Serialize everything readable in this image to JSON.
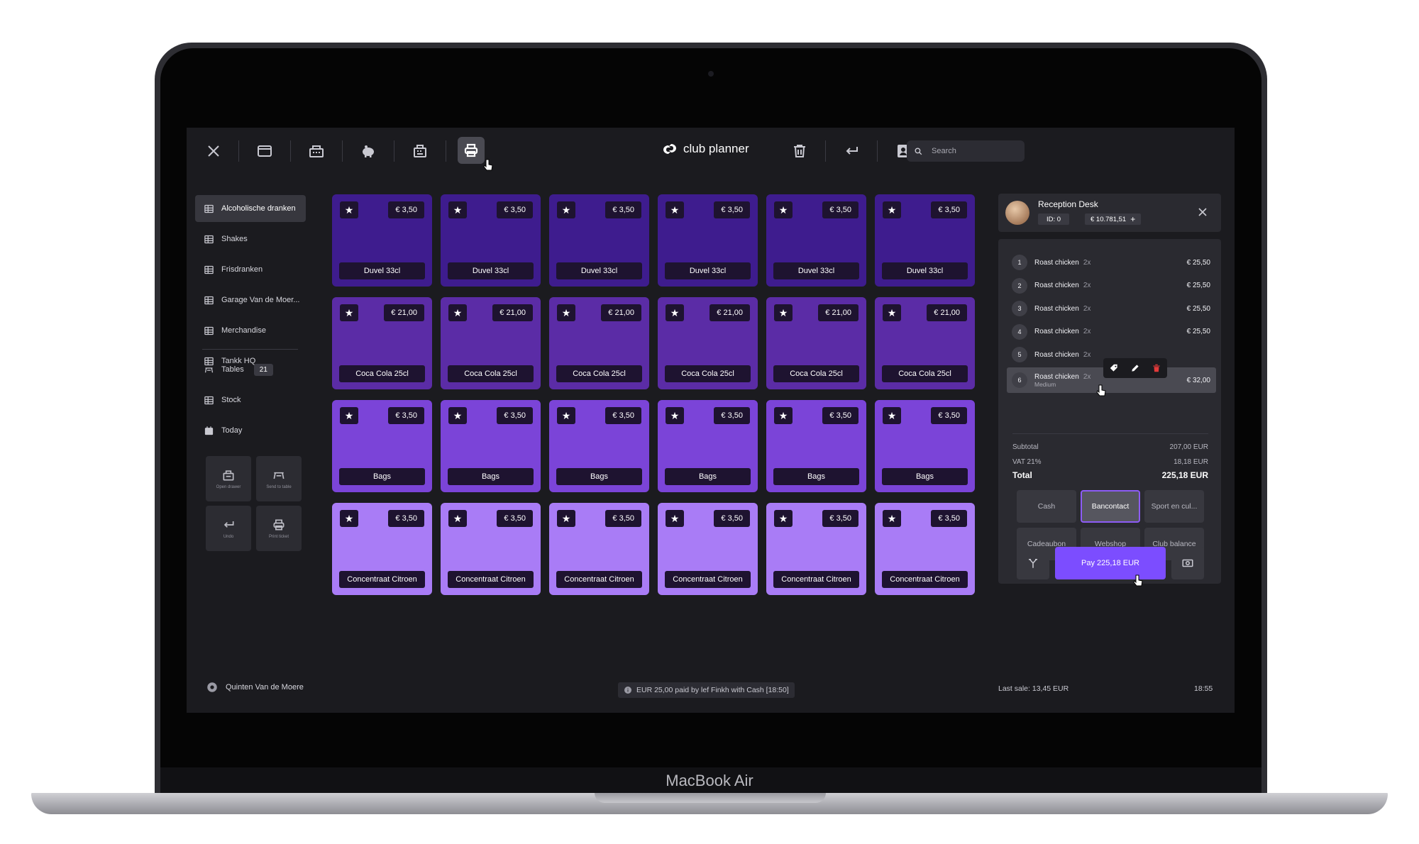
{
  "device": {
    "label": "MacBook Air"
  },
  "header": {
    "logo_text": "club planner",
    "search_placeholder": "Search",
    "toolbar_icons": [
      "close-icon",
      "wallet-icon",
      "cash-register-icon",
      "piggy-bank-icon",
      "calculator-icon",
      "printer-icon",
      "trash-icon",
      "return-icon",
      "contact-card-icon",
      "search-icon"
    ]
  },
  "sidebar": {
    "categories": [
      {
        "label": "Alcoholische dranken",
        "active": true
      },
      {
        "label": "Shakes"
      },
      {
        "label": "Frisdranken"
      },
      {
        "label": "Garage Van de Moer..."
      },
      {
        "label": "Merchandise"
      },
      {
        "label": "Tankk HQ"
      }
    ],
    "tables": {
      "label": "Tables",
      "count": "21"
    },
    "stock": {
      "label": "Stock"
    },
    "today": {
      "label": "Today"
    },
    "quick_actions": [
      {
        "label": "Open drawer"
      },
      {
        "label": "Send to table"
      },
      {
        "label": "Undo"
      },
      {
        "label": "Print ticket"
      }
    ],
    "user": {
      "name": "Quinten Van de Moere"
    }
  },
  "products": {
    "rows": [
      {
        "name": "Duvel 33cl",
        "price": "€ 3,50",
        "color": "#3e1c8e"
      },
      {
        "name": "Coca Cola 25cl",
        "price": "€ 21,00",
        "color": "#5b2ca6"
      },
      {
        "name": "Bags",
        "price": "€ 3,50",
        "color": "#7b44d8"
      },
      {
        "name": "Concentraat Citroen",
        "price": "€ 3,50",
        "color": "#a97cf6"
      }
    ],
    "star_glyph": "★"
  },
  "customer": {
    "name": "Reception Desk",
    "id": "ID: 0",
    "balance": "€ 10.781,51",
    "add_glyph": "+"
  },
  "ticket": {
    "lines": [
      {
        "num": "1",
        "name": "Roast chicken",
        "qty": "2x",
        "amount": "€ 25,50"
      },
      {
        "num": "2",
        "name": "Roast chicken",
        "qty": "2x",
        "amount": "€ 25,50"
      },
      {
        "num": "3",
        "name": "Roast chicken",
        "qty": "2x",
        "amount": "€ 25,50"
      },
      {
        "num": "4",
        "name": "Roast chicken",
        "qty": "2x",
        "amount": "€ 25,50"
      },
      {
        "num": "5",
        "name": "Roast chicken",
        "qty": "2x",
        "amount": ""
      },
      {
        "num": "6",
        "name": "Roast chicken",
        "qty": "2x",
        "amount": "€ 32,00",
        "note": "Medium",
        "selected": true
      }
    ]
  },
  "totals": {
    "subtotal_label": "Subtotal",
    "subtotal": "207,00 EUR",
    "vat_label": "VAT 21%",
    "vat": "18,18 EUR",
    "total_label": "Total",
    "total": "225,18 EUR"
  },
  "payment_methods": [
    {
      "label": "Cash"
    },
    {
      "label": "Bancontact",
      "selected": true
    },
    {
      "label": "Sport en cul..."
    },
    {
      "label": "Cadeaubon"
    },
    {
      "label": "Webshop"
    },
    {
      "label": "Club balance"
    }
  ],
  "pay_button": {
    "label": "Pay 225,18 EUR"
  },
  "footer": {
    "notice": "EUR 25,00 paid by lef Finkh with Cash [18:50]",
    "last_sale": "Last sale: 13,45 EUR",
    "time": "18:55"
  },
  "colors": {
    "accent": "#7c4dff",
    "background": "#1b1b1f",
    "panel": "#2a2a30"
  }
}
